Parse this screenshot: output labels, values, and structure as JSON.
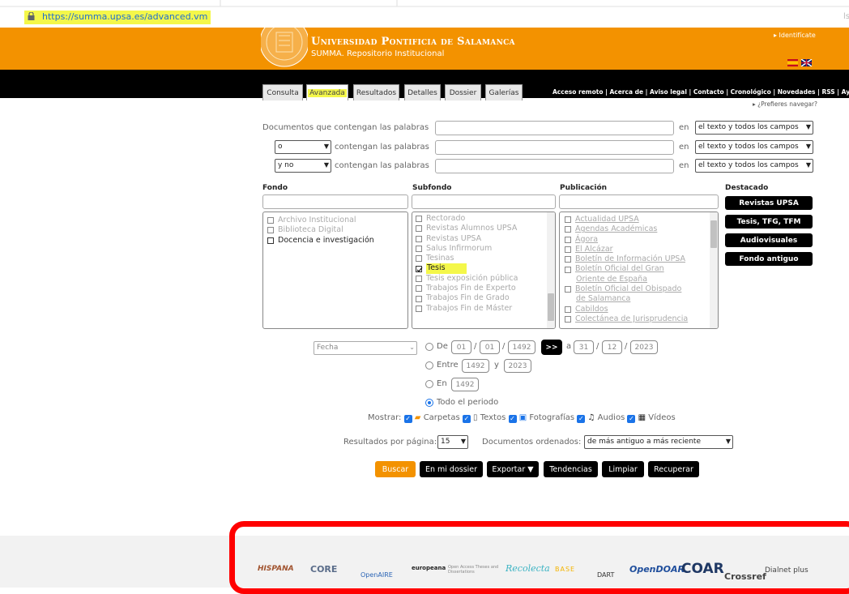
{
  "browser": {
    "url": "https://summa.upsa.es/advanced.vm",
    "right_mark": "ls"
  },
  "header": {
    "university": "Universidad Pontificia de Salamanca",
    "repository": "SUMMA. Repositorio Institucional",
    "login": "▸ Identifícate"
  },
  "tabs": [
    "Consulta",
    "Avanzada",
    "Resultados",
    "Detalles",
    "Dossier",
    "Galerías"
  ],
  "top_links": "Acceso remoto | Acerca de | Aviso legal | Contacto | Cronológico | Novedades | RSS | Ayuda",
  "prefer_browse": "▸ ¿Prefieres navegar?",
  "search": {
    "row1_label": "Documentos que contengan las palabras",
    "row_label": "contengan las palabras",
    "op1": "o",
    "op2": "y no",
    "en": "en",
    "field_scope": "el texto y todos los campos"
  },
  "facets": {
    "fondo": {
      "title": "Fondo",
      "items": [
        "Archivo Institucional",
        "Biblioteca Digital",
        "Docencia e investigación"
      ]
    },
    "subfondo": {
      "title": "Subfondo",
      "items": [
        "Rectorado",
        "Revistas Alumnos UPSA",
        "Revistas UPSA",
        "Salus Infirmorum",
        "Tesinas",
        "Tesis",
        "Tesis exposición pública",
        "Trabajos Fin de Experto",
        "Trabajos Fin de Grado",
        "Trabajos Fin de Máster"
      ]
    },
    "publicacion": {
      "title": "Publicación",
      "items": [
        "Actualidad UPSA",
        "Agendas Académicas",
        "Ágora",
        "El Alcázar",
        "Boletín de Información UPSA",
        "Boletín Oficial del Gran",
        "Oriente de España",
        "Boletín Oficial del Obispado",
        "de Salamanca",
        "Cabildos",
        "Colectánea de Jurisprudencia"
      ]
    },
    "destacado": {
      "title": "Destacado",
      "buttons": [
        "Revistas UPSA",
        "Tesis, TFG, TFM",
        "Audiovisuales",
        "Fondo antiguo"
      ]
    }
  },
  "dates": {
    "field": "Fecha",
    "de": "De",
    "from_d": "01",
    "from_m": "01",
    "from_y": "1492",
    "arrow": ">>",
    "a": "a",
    "to_d": "31",
    "to_m": "12",
    "to_y": "2023",
    "entre": "Entre",
    "e1": "1492",
    "y": "y",
    "e2": "2023",
    "en": "En",
    "en_y": "1492",
    "todo": "Todo el periodo"
  },
  "show": {
    "label": "Mostrar:",
    "items": [
      "Carpetas",
      "Textos",
      "Fotografías",
      "Audios",
      "Vídeos"
    ]
  },
  "paging": {
    "label": "Resultados por página:",
    "value": "15",
    "order_label": "Documentos ordenados:",
    "order": "de más antiguo a más reciente"
  },
  "actions": [
    "Buscar",
    "En mi dossier",
    "Exportar ▼",
    "Tendencias",
    "Limpiar",
    "Recuperar"
  ],
  "footer_logos": [
    "HISPANA",
    "CORE",
    "OpenAIRE",
    "europeana",
    "Open Access Theses and Dissertations",
    "Recolecta",
    "BASE",
    "DART",
    "OpenDOAR",
    "COAR",
    "Crossref",
    "Dialnet plus"
  ],
  "colors": {
    "brand": "#f39200",
    "highlight": "#f4f74a",
    "annotation": "#ff0000"
  }
}
